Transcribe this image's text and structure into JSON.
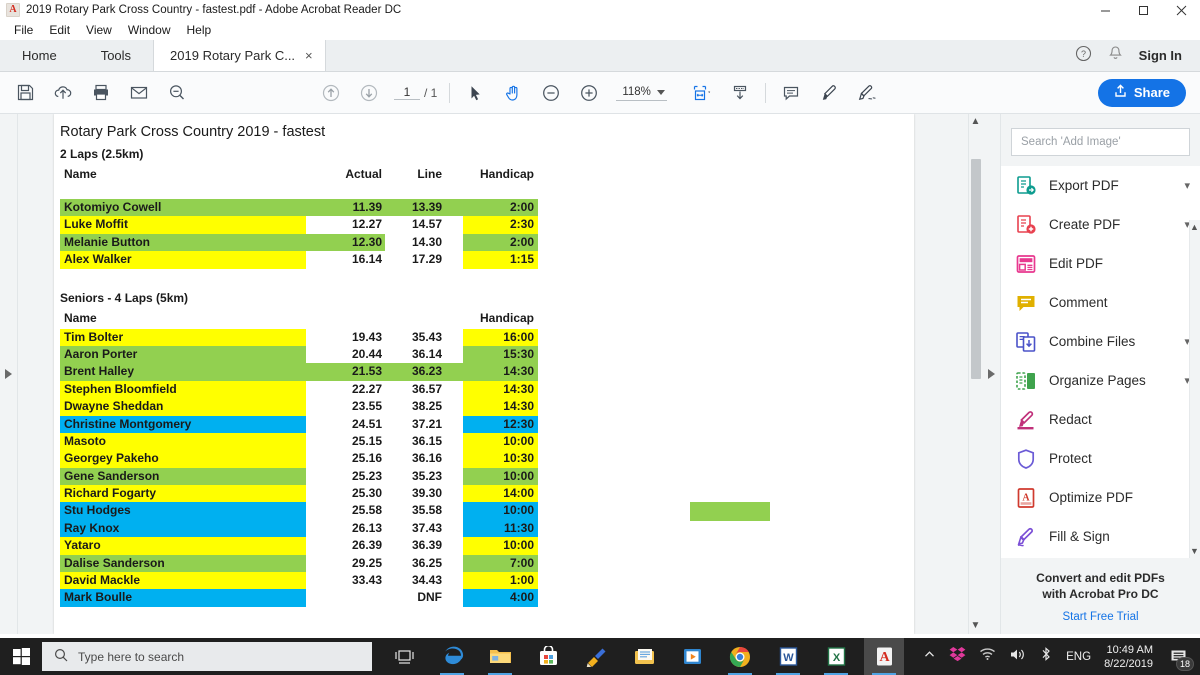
{
  "window": {
    "title": "2019 Rotary Park Cross Country - fastest.pdf - Adobe Acrobat Reader DC",
    "minimize": "minimize",
    "maximize": "maximize",
    "close": "close"
  },
  "menubar": [
    "File",
    "Edit",
    "View",
    "Window",
    "Help"
  ],
  "tabs": {
    "home": "Home",
    "tools": "Tools",
    "document": "2019 Rotary Park C...",
    "close_tab": "×",
    "help_icon": "help-icon",
    "bell_icon": "bell-icon",
    "sign_in": "Sign In"
  },
  "toolbar": {
    "save": "save-icon",
    "upload": "upload-cloud-icon",
    "print": "print-icon",
    "email": "email-icon",
    "search": "search-icon",
    "prev_page": "previous-page-icon",
    "next_page": "next-page-icon",
    "page_current": "1",
    "page_total": "/ 1",
    "select_tool": "cursor-icon",
    "hand_tool": "hand-icon",
    "zoom_out": "zoom-out-icon",
    "zoom_in": "zoom-in-icon",
    "zoom_level": "118%",
    "fit_page": "fit-page-icon",
    "scroll_mode": "scroll-mode-icon",
    "comment": "comment-icon",
    "highlight": "highlight-icon",
    "sign": "sign-icon",
    "share_label": "Share",
    "share_color": "#1473e6"
  },
  "document": {
    "title": "Rotary Park Cross Country 2019 - fastest",
    "section1": {
      "subtitle": "2 Laps (2.5km)",
      "headers": {
        "name": "Name",
        "actual": "Actual",
        "line": "Line",
        "handicap": "Handicap"
      },
      "rows": [
        {
          "name": "Kotomiyo Cowell",
          "actual": "11.39",
          "line": "13.39",
          "handicap": "2:00",
          "fill": "green",
          "full_row": true
        },
        {
          "name": "Luke Moffit",
          "actual": "12.27",
          "line": "14.57",
          "handicap": "2:30",
          "fill": "yellow",
          "full_row": false
        },
        {
          "name": "Melanie Button",
          "actual": "12.30",
          "line": "14.30",
          "handicap": "2:00",
          "fill": "green",
          "full_row": false,
          "actual_fill": true
        },
        {
          "name": "Alex Walker",
          "actual": "16.14",
          "line": "17.29",
          "handicap": "1:15",
          "fill": "yellow",
          "full_row": false
        }
      ]
    },
    "section2": {
      "subtitle": "Seniors - 4 Laps (5km)",
      "headers": {
        "name": "Name",
        "actual": "",
        "line": "",
        "handicap": "Handicap"
      },
      "rows": [
        {
          "name": "Tim Bolter",
          "actual": "19.43",
          "line": "35.43",
          "handicap": "16:00",
          "fill": "yellow",
          "full_row": false
        },
        {
          "name": "Aaron Porter",
          "actual": "20.44",
          "line": "36.14",
          "handicap": "15:30",
          "fill": "green",
          "full_row": false
        },
        {
          "name": "Brent Halley",
          "actual": "21.53",
          "line": "36.23",
          "handicap": "14:30",
          "fill": "green",
          "full_row": true
        },
        {
          "name": "Stephen Bloomfield",
          "actual": "22.27",
          "line": "36.57",
          "handicap": "14:30",
          "fill": "yellow",
          "full_row": false
        },
        {
          "name": "Dwayne Sheddan",
          "actual": "23.55",
          "line": "38.25",
          "handicap": "14:30",
          "fill": "yellow",
          "full_row": false
        },
        {
          "name": "Christine Montgomery",
          "actual": "24.51",
          "line": "37.21",
          "handicap": "12:30",
          "fill": "blue",
          "full_row": false
        },
        {
          "name": "Masoto",
          "actual": "25.15",
          "line": "36.15",
          "handicap": "10:00",
          "fill": "yellow",
          "full_row": false
        },
        {
          "name": "Georgey Pakeho",
          "actual": "25.16",
          "line": "36.16",
          "handicap": "10:30",
          "fill": "yellow",
          "full_row": false
        },
        {
          "name": "Gene Sanderson",
          "actual": "25.23",
          "line": "35.23",
          "handicap": "10:00",
          "fill": "green",
          "full_row": false
        },
        {
          "name": "Richard Fogarty",
          "actual": "25.30",
          "line": "39.30",
          "handicap": "14:00",
          "fill": "yellow",
          "full_row": false
        },
        {
          "name": "Stu Hodges",
          "actual": "25.58",
          "line": "35.58",
          "handicap": "10:00",
          "fill": "blue",
          "full_row": false
        },
        {
          "name": "Ray Knox",
          "actual": "26.13",
          "line": "37.43",
          "handicap": "11:30",
          "fill": "blue",
          "full_row": false
        },
        {
          "name": "Yataro",
          "actual": "26.39",
          "line": "36.39",
          "handicap": "10:00",
          "fill": "yellow",
          "full_row": false
        },
        {
          "name": "Dalise Sanderson",
          "actual": "29.25",
          "line": "36.25",
          "handicap": "7:00",
          "fill": "green",
          "full_row": false
        },
        {
          "name": "David Mackle",
          "actual": "33.43",
          "line": "34.43",
          "handicap": "1:00",
          "fill": "yellow",
          "full_row": false
        },
        {
          "name": "Mark Boulle",
          "actual": "",
          "line": "DNF",
          "handicap": "4:00",
          "fill": "blue",
          "full_row": false
        }
      ]
    },
    "highlight_colors": {
      "green": "#92d050",
      "yellow": "#ffff00",
      "blue": "#00b0f0"
    },
    "stray_highlight": "green"
  },
  "right_panel": {
    "search_placeholder": "Search 'Add Image'",
    "tools": [
      {
        "label": "Export PDF",
        "icon": "export-pdf-icon",
        "color": "#0d9c8f",
        "chevron": "⌄"
      },
      {
        "label": "Create PDF",
        "icon": "create-pdf-icon",
        "color": "#e8414f",
        "chevron": "⌄"
      },
      {
        "label": "Edit PDF",
        "icon": "edit-pdf-icon",
        "color": "#e8388f",
        "chevron": ""
      },
      {
        "label": "Comment",
        "icon": "comment-icon",
        "color": "#e0b000",
        "chevron": ""
      },
      {
        "label": "Combine Files",
        "icon": "combine-files-icon",
        "color": "#4a52c8",
        "chevron": "⌄"
      },
      {
        "label": "Organize Pages",
        "icon": "organize-pages-icon",
        "color": "#3fa34d",
        "chevron": "⌄"
      },
      {
        "label": "Redact",
        "icon": "redact-icon",
        "color": "#c0307a",
        "chevron": ""
      },
      {
        "label": "Protect",
        "icon": "protect-icon",
        "color": "#6b5bd6",
        "chevron": ""
      },
      {
        "label": "Optimize PDF",
        "icon": "optimize-pdf-icon",
        "color": "#d03a2e",
        "chevron": ""
      },
      {
        "label": "Fill & Sign",
        "icon": "fill-sign-icon",
        "color": "#7b4fd6",
        "chevron": ""
      }
    ],
    "promo_line1": "Convert and edit PDFs",
    "promo_line2": "with Acrobat Pro DC",
    "promo_cta": "Start Free Trial"
  },
  "taskbar": {
    "start": "windows-start-icon",
    "search_placeholder": "Type here to search",
    "task_view": "task-view-icon",
    "apps": [
      {
        "name": "edge-icon"
      },
      {
        "name": "file-explorer-icon"
      },
      {
        "name": "microsoft-store-icon"
      },
      {
        "name": "paint-3d-icon"
      },
      {
        "name": "mail-icon"
      },
      {
        "name": "movies-tv-icon"
      },
      {
        "name": "chrome-icon"
      },
      {
        "name": "word-icon"
      },
      {
        "name": "excel-icon"
      },
      {
        "name": "acrobat-reader-icon"
      }
    ],
    "tray": {
      "overflow": "show-hidden-icons",
      "dropbox": "dropbox-icon",
      "wifi": "wifi-icon",
      "volume": "volume-icon",
      "bluetooth": "bluetooth-icon",
      "language": "ENG",
      "time": "10:49 AM",
      "date": "8/22/2019",
      "notifications": "18"
    }
  }
}
